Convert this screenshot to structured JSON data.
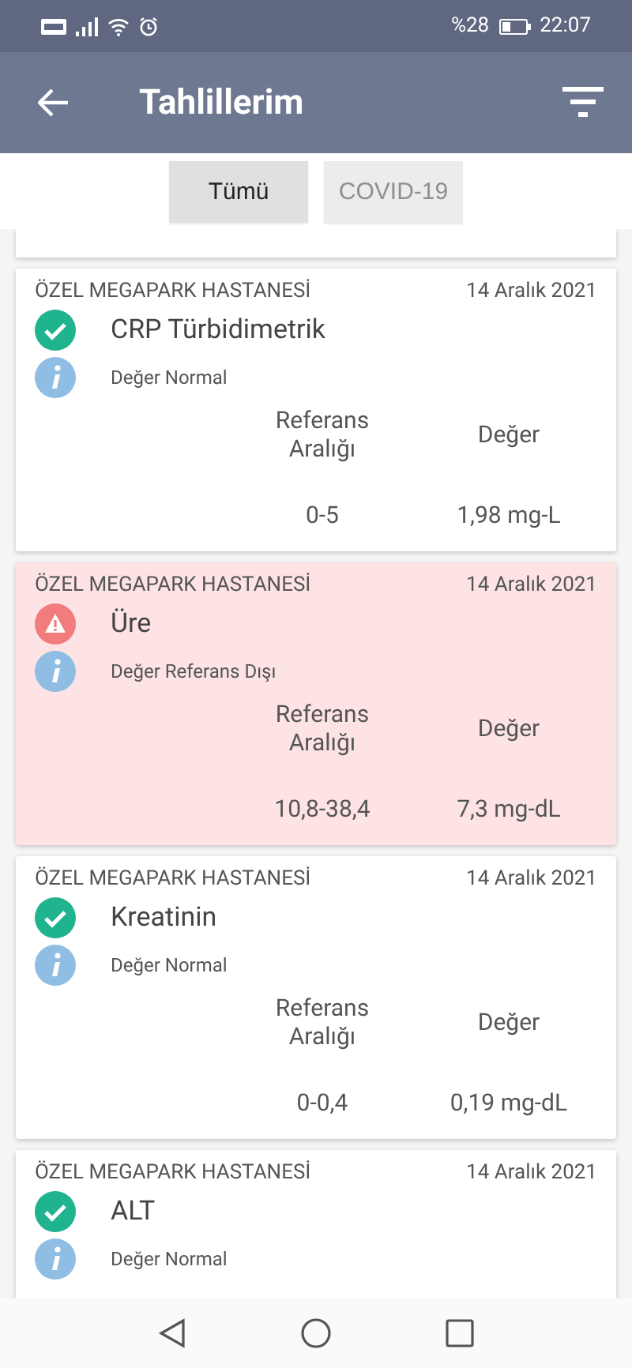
{
  "status_bar": {
    "battery": "%28",
    "time": "22:07"
  },
  "app_bar": {
    "title": "Tahlillerim"
  },
  "filter_tabs": [
    {
      "label": "Tümü",
      "selected": true
    },
    {
      "label": "COVID-19",
      "selected": false
    }
  ],
  "results": [
    {
      "hospital": "ÖZEL MEGAPARK HASTANESİ",
      "date": "14 Aralık 2021",
      "name": "CRP Türbidimetrik",
      "kind": "normal",
      "note": "Değer Normal",
      "ref_header": "Referans Aralığı",
      "value_header": "Değer",
      "ref": "0-5",
      "value": "1,98 mg-L"
    },
    {
      "hospital": "ÖZEL MEGAPARK HASTANESİ",
      "date": "14 Aralık 2021",
      "name": "Üre",
      "kind": "abnormal",
      "note": "Değer Referans Dışı",
      "ref_header": "Referans Aralığı",
      "value_header": "Değer",
      "ref": "10,8-38,4",
      "value": "7,3 mg-dL"
    },
    {
      "hospital": "ÖZEL MEGAPARK HASTANESİ",
      "date": "14 Aralık 2021",
      "name": "Kreatinin",
      "kind": "normal",
      "note": "Değer Normal",
      "ref_header": "Referans Aralığı",
      "value_header": "Değer",
      "ref": "0-0,4",
      "value": "0,19 mg-dL"
    },
    {
      "hospital": "ÖZEL MEGAPARK HASTANESİ",
      "date": "14 Aralık 2021",
      "name": "ALT",
      "kind": "normal",
      "note": "Değer Normal"
    }
  ]
}
